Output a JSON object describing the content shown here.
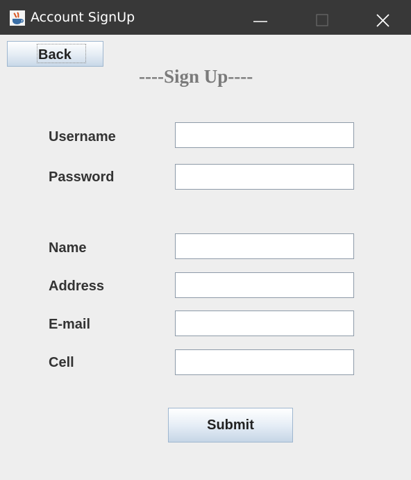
{
  "window": {
    "title": "Account SignUp",
    "app_icon": "java-cup-icon",
    "controls": {
      "minimize_icon": "minimize-icon",
      "maximize_icon": "maximize-icon",
      "close_icon": "close-icon"
    },
    "titlebar_color": "#383838"
  },
  "toolbar": {
    "back_label": "Back"
  },
  "form": {
    "heading": "----Sign Up----",
    "fields": [
      {
        "label": "Username",
        "value": "",
        "placeholder": ""
      },
      {
        "label": "Password",
        "value": "",
        "placeholder": ""
      },
      {
        "label": "Name",
        "value": "",
        "placeholder": ""
      },
      {
        "label": "Address",
        "value": "",
        "placeholder": ""
      },
      {
        "label": "E-mail",
        "value": "",
        "placeholder": ""
      },
      {
        "label": "Cell",
        "value": "",
        "placeholder": ""
      }
    ],
    "submit_label": "Submit"
  },
  "colors": {
    "background": "#eeeeee",
    "heading": "#7a7a7a",
    "button_border": "#9eb6cf"
  }
}
